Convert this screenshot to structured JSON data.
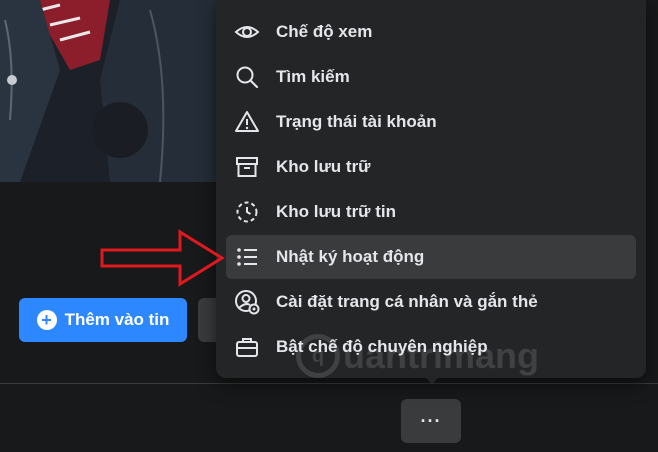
{
  "profile": {
    "add_story_label": "Thêm vào tin",
    "add_story_icon": "plus-circle-icon",
    "more_button_label": "···"
  },
  "menu": {
    "items": [
      {
        "label": "Chế độ xem",
        "icon": "eye-icon"
      },
      {
        "label": "Tìm kiếm",
        "icon": "search-icon"
      },
      {
        "label": "Trạng thái tài khoản",
        "icon": "warning-icon"
      },
      {
        "label": "Kho lưu trữ",
        "icon": "archive-icon"
      },
      {
        "label": "Kho lưu trữ tin",
        "icon": "story-archive-icon"
      },
      {
        "label": "Nhật ký hoạt động",
        "icon": "activity-list-icon",
        "highlighted": true
      },
      {
        "label": "Cài đặt trang cá nhân và gắn thẻ",
        "icon": "profile-settings-icon"
      },
      {
        "label": "Bật chế độ chuyên nghiệp",
        "icon": "briefcase-icon"
      }
    ]
  },
  "annotation": {
    "arrow_color": "#e0191e",
    "pointer_icon": "red-arrow-icon"
  },
  "watermark": {
    "text": "uantrimang",
    "logo_letter": "q"
  },
  "colors": {
    "accent": "#2d88ff",
    "menu_bg": "#242526",
    "page_bg": "#18191a",
    "text": "#e4e6eb",
    "highlight": "#3a3b3c"
  }
}
